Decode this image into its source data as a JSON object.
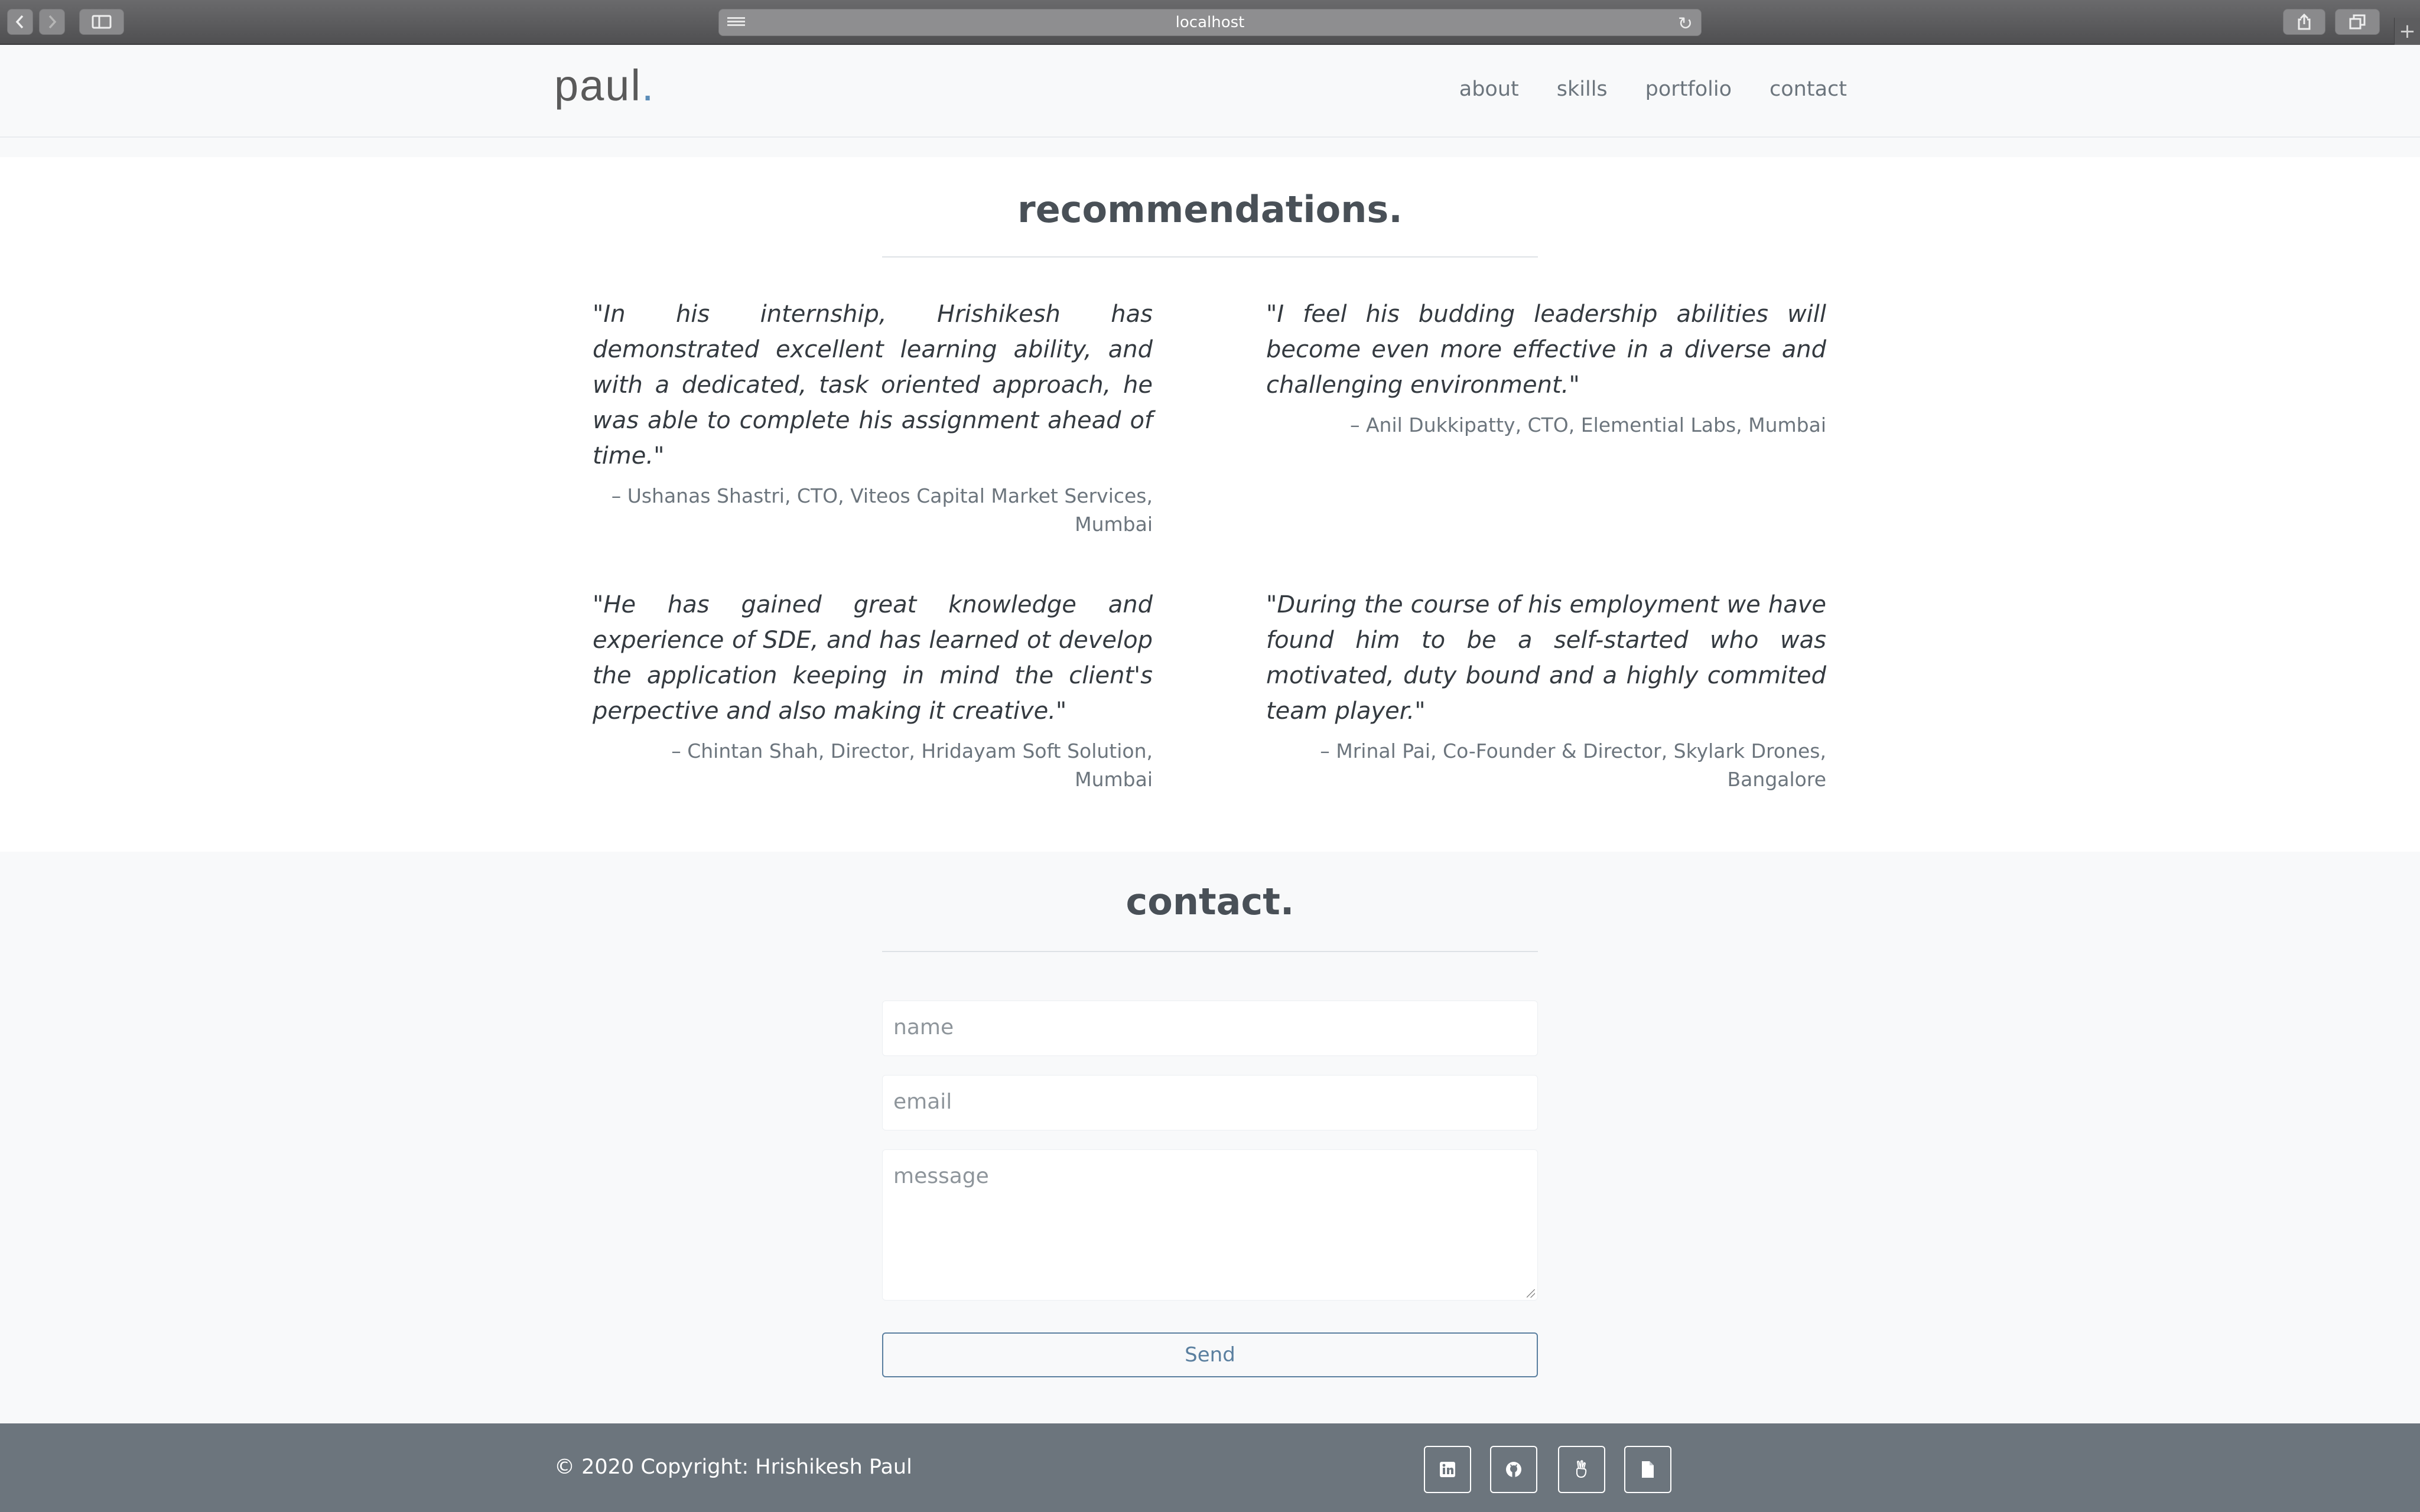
{
  "browser": {
    "address": "localhost"
  },
  "nav": {
    "logo_text": "paul",
    "logo_dot": ".",
    "links": [
      "about",
      "skills",
      "portfolio",
      "contact"
    ]
  },
  "recommendations": {
    "title": "recommendations.",
    "items": [
      {
        "quote": "\"In his internship, Hrishikesh has demonstrated excellent learning ability, and with a dedicated, task oriented approach, he was able to complete his assignment ahead of time.\"",
        "author": "– Ushanas Shastri, CTO, Viteos Capital Market Services, Mumbai"
      },
      {
        "quote": "\"I feel his budding leadership abilities will become even more effective in a diverse and challenging environment.\"",
        "author": "– Anil Dukkipatty, CTO, Elemential Labs, Mumbai"
      },
      {
        "quote": "\"He has gained great knowledge and experience of SDE, and has learned ot develop the application keeping in mind the client's perpective and also making it creative.\"",
        "author": "– Chintan Shah, Director, Hridayam Soft Solution, Mumbai"
      },
      {
        "quote": "\"During the course of his employment we have found him to be a self-started who was motivated, duty bound and a highly commited team player.\"",
        "author": "– Mrinal Pai, Co-Founder & Director, Skylark Drones, Bangalore"
      }
    ]
  },
  "contact": {
    "title": "contact.",
    "name_placeholder": "name",
    "email_placeholder": "email",
    "message_placeholder": "message",
    "send_label": "Send"
  },
  "footer": {
    "copyright": "© 2020 Copyright: Hrishikesh Paul",
    "icons": [
      "linkedin-icon",
      "github-icon",
      "angellist-icon",
      "resume-file-icon"
    ]
  },
  "colors": {
    "accent": "#5b8db8",
    "button": "#5a7f9f",
    "footer": "#6c757d",
    "nav_bg": "#f8f9fa"
  }
}
